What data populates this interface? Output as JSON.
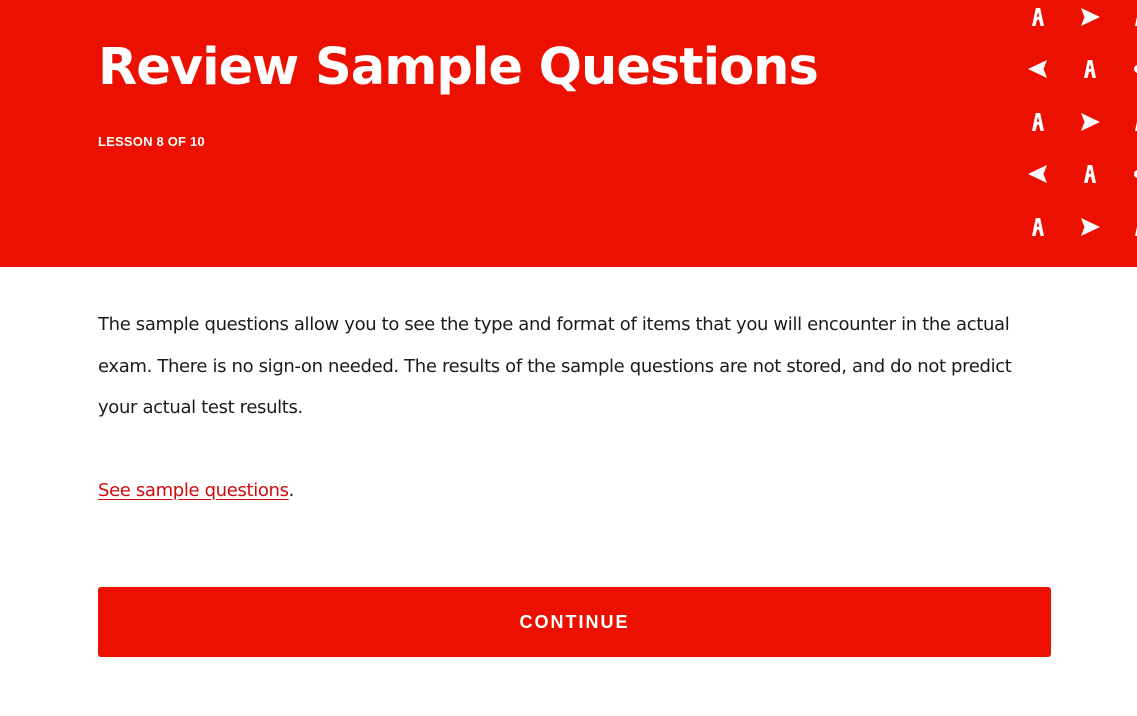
{
  "header": {
    "title": "Review Sample Questions",
    "lesson_label": "LESSON 8 OF 10",
    "background_color": "#eb1000",
    "pattern_icons": [
      "adobe-a-icon",
      "play-triangle-icon",
      "back-triangle-icon"
    ]
  },
  "main": {
    "description": "The sample questions allow you to see the type and format of items that you will encounter in the actual exam. There is no sign-on needed. The results of the sample questions are not stored, and do not predict your actual test results.",
    "link_text": "See sample questions",
    "link_suffix": "."
  },
  "footer": {
    "continue_label": "CONTINUE"
  },
  "colors": {
    "accent": "#eb1000",
    "link": "#d00b0b",
    "text": "#1b1b1b"
  }
}
